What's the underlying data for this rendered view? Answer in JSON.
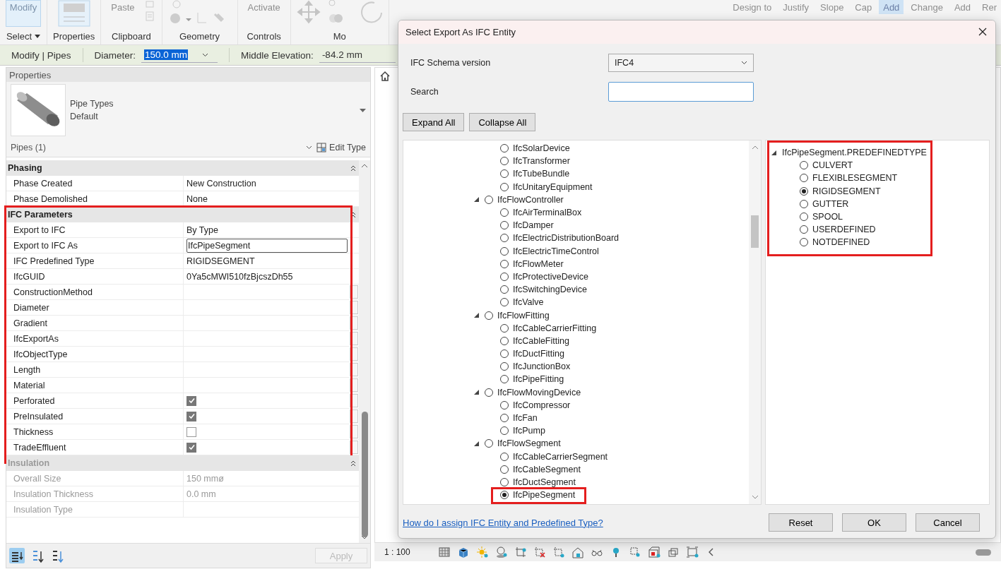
{
  "ribbon": {
    "panels": [
      {
        "label": "Select",
        "has_menu": true,
        "tools": [
          {
            "kind": "big",
            "label": "Modify"
          }
        ]
      },
      {
        "label": "Properties",
        "tools": [
          {
            "kind": "properties"
          }
        ]
      },
      {
        "label": "Clipboard",
        "tools": [
          {
            "kind": "text",
            "label": "Paste",
            "selected": false
          },
          {
            "kind": "clipboard"
          }
        ]
      },
      {
        "label": "Geometry",
        "tools": [
          {
            "kind": "geometry"
          }
        ]
      },
      {
        "label": "Controls",
        "tools": [
          {
            "kind": "text",
            "label": "Activate",
            "selected": false
          }
        ]
      },
      {
        "label": "Mo",
        "tools": [
          {
            "kind": "move"
          },
          {
            "kind": "rotate"
          }
        ]
      },
      {
        "tools": [
          {
            "kind": "text",
            "label": "Design to",
            "selected": false
          },
          {
            "kind": "text",
            "label": "Justify",
            "selected": false
          },
          {
            "kind": "text",
            "label": "Slope",
            "selected": false
          },
          {
            "kind": "text",
            "label": "Cap",
            "selected": false
          },
          {
            "kind": "text",
            "label": "Add",
            "selected": true
          },
          {
            "kind": "text",
            "label": "Change",
            "selected": false
          },
          {
            "kind": "text",
            "label": "Add",
            "selected": false
          },
          {
            "kind": "text",
            "label": "Rer",
            "selected": false
          }
        ]
      }
    ]
  },
  "options_bar": {
    "context": "Modify | Pipes",
    "diameter": {
      "label": "Diameter:",
      "value": "150.0 mm"
    },
    "elevation": {
      "label": "Middle Elevation:",
      "value": "-84.2 mm"
    }
  },
  "properties": {
    "title": "Properties",
    "type_selector": {
      "family": "Pipe Types",
      "type": "Default"
    },
    "filter": "Pipes (1)",
    "edit_type": "Edit Type",
    "groups": [
      {
        "name": "Phasing",
        "disabled": false,
        "rows": [
          {
            "label": "Phase Created",
            "kind": "text",
            "value": "New Construction"
          },
          {
            "label": "Phase Demolished",
            "kind": "text",
            "value": "None"
          }
        ]
      },
      {
        "name": "IFC Parameters",
        "highlighted": true,
        "disabled": false,
        "rows": [
          {
            "label": "Export to IFC",
            "kind": "text",
            "value": "By Type"
          },
          {
            "label": "Export to IFC As",
            "kind": "field",
            "value": "IfcPipeSegment"
          },
          {
            "label": "IFC Predefined Type",
            "kind": "text",
            "value": "RIGIDSEGMENT"
          },
          {
            "label": "IfcGUID",
            "kind": "text",
            "value": "0Ya5cMWI510fzBjcszDh55"
          },
          {
            "label": "ConstructionMethod",
            "kind": "param"
          },
          {
            "label": "Diameter",
            "kind": "param"
          },
          {
            "label": "Gradient",
            "kind": "param"
          },
          {
            "label": "IfcExportAs",
            "kind": "param"
          },
          {
            "label": "IfcObjectType",
            "kind": "param"
          },
          {
            "label": "Length",
            "kind": "param"
          },
          {
            "label": "Material",
            "kind": "param"
          },
          {
            "label": "Perforated",
            "kind": "checkbox",
            "checked": true
          },
          {
            "label": "PreInsulated",
            "kind": "checkbox",
            "checked": true
          },
          {
            "label": "Thickness",
            "kind": "checkbox",
            "checked": false
          },
          {
            "label": "TradeEffluent",
            "kind": "checkbox",
            "checked": true
          }
        ]
      },
      {
        "name": "Insulation",
        "disabled": true,
        "rows": [
          {
            "label": "Overall Size",
            "kind": "text",
            "value": "150 mmø"
          },
          {
            "label": "Insulation Thickness",
            "kind": "text",
            "value": "0.0 mm"
          },
          {
            "label": "Insulation Type",
            "kind": "text"
          }
        ]
      }
    ],
    "sort_buttons": [
      {
        "kind": "categorized",
        "selected": true
      },
      {
        "kind": "ascending",
        "selected": false
      },
      {
        "kind": "descending",
        "selected": false
      }
    ],
    "apply": {
      "label": "Apply",
      "disabled": true
    }
  },
  "status_bar": {
    "scale": "1 : 100"
  },
  "dialog": {
    "title": "Select Export As IFC Entity",
    "schema": {
      "label": "IFC Schema version",
      "value": "IFC4"
    },
    "search": {
      "label": "Search"
    },
    "expand_all": "Expand All",
    "collapse_all": "Collapse All",
    "tree": {
      "continued_items": [
        {
          "label": "IfcSolarDevice",
          "selected": false,
          "highlighted": false
        },
        {
          "label": "IfcTransformer",
          "selected": false,
          "highlighted": false
        },
        {
          "label": "IfcTubeBundle",
          "selected": false,
          "highlighted": false
        },
        {
          "label": "IfcUnitaryEquipment",
          "selected": false,
          "highlighted": false
        }
      ],
      "nodes": [
        {
          "label": "IfcFlowController",
          "selected": false,
          "expanded": true,
          "children": [
            {
              "label": "IfcAirTerminalBox",
              "selected": false,
              "highlighted": false
            },
            {
              "label": "IfcDamper",
              "selected": false,
              "highlighted": false
            },
            {
              "label": "IfcElectricDistributionBoard",
              "selected": false,
              "highlighted": false
            },
            {
              "label": "IfcElectricTimeControl",
              "selected": false,
              "highlighted": false
            },
            {
              "label": "IfcFlowMeter",
              "selected": false,
              "highlighted": false
            },
            {
              "label": "IfcProtectiveDevice",
              "selected": false,
              "highlighted": false
            },
            {
              "label": "IfcSwitchingDevice",
              "selected": false,
              "highlighted": false
            },
            {
              "label": "IfcValve",
              "selected": false,
              "highlighted": false
            }
          ]
        },
        {
          "label": "IfcFlowFitting",
          "selected": false,
          "expanded": true,
          "children": [
            {
              "label": "IfcCableCarrierFitting",
              "selected": false,
              "highlighted": false
            },
            {
              "label": "IfcCableFitting",
              "selected": false,
              "highlighted": false
            },
            {
              "label": "IfcDuctFitting",
              "selected": false,
              "highlighted": false
            },
            {
              "label": "IfcJunctionBox",
              "selected": false,
              "highlighted": false
            },
            {
              "label": "IfcPipeFitting",
              "selected": false,
              "highlighted": false
            }
          ]
        },
        {
          "label": "IfcFlowMovingDevice",
          "selected": false,
          "expanded": true,
          "children": [
            {
              "label": "IfcCompressor",
              "selected": false,
              "highlighted": false
            },
            {
              "label": "IfcFan",
              "selected": false,
              "highlighted": false
            },
            {
              "label": "IfcPump",
              "selected": false,
              "highlighted": false
            }
          ]
        },
        {
          "label": "IfcFlowSegment",
          "selected": false,
          "expanded": true,
          "children": [
            {
              "label": "IfcCableCarrierSegment",
              "selected": false,
              "highlighted": false
            },
            {
              "label": "IfcCableSegment",
              "selected": false,
              "highlighted": false
            },
            {
              "label": "IfcDuctSegment",
              "selected": false,
              "highlighted": false
            },
            {
              "label": "IfcPipeSegment",
              "selected": true,
              "highlighted": true
            }
          ]
        }
      ]
    },
    "predefined": {
      "label": "IfcPipeSegment.PREDEFINEDTYPE",
      "expanded": true,
      "highlighted": true,
      "options": [
        {
          "label": "CULVERT",
          "selected": false
        },
        {
          "label": "FLEXIBLESEGMENT",
          "selected": false
        },
        {
          "label": "RIGIDSEGMENT",
          "selected": true
        },
        {
          "label": "GUTTER",
          "selected": false
        },
        {
          "label": "SPOOL",
          "selected": false
        },
        {
          "label": "USERDEFINED",
          "selected": false
        },
        {
          "label": "NOTDEFINED",
          "selected": false
        }
      ]
    },
    "help_link": "How do I assign IFC Entity and Predefined Type?",
    "actions": [
      "Reset",
      "OK",
      "Cancel"
    ]
  }
}
